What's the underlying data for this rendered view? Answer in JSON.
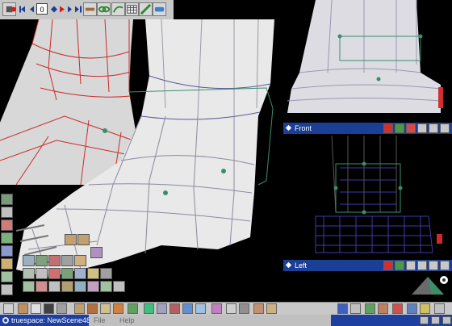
{
  "toolbar": {
    "frame_value": "0"
  },
  "main_view": {
    "label": ""
  },
  "front_view": {
    "title": "Front"
  },
  "left_view": {
    "title": "Left"
  },
  "status": {
    "app_title": "truespace: NewScene48"
  },
  "menu": {
    "items": [
      "File",
      "Help"
    ]
  },
  "colors": {
    "title_bar": "#1c3f96",
    "toolbar": "#c8c8c8",
    "mesh_red": "#cc2a2a",
    "mesh_green": "#3a8f6a",
    "wire_blue": "#3a3ab0"
  }
}
